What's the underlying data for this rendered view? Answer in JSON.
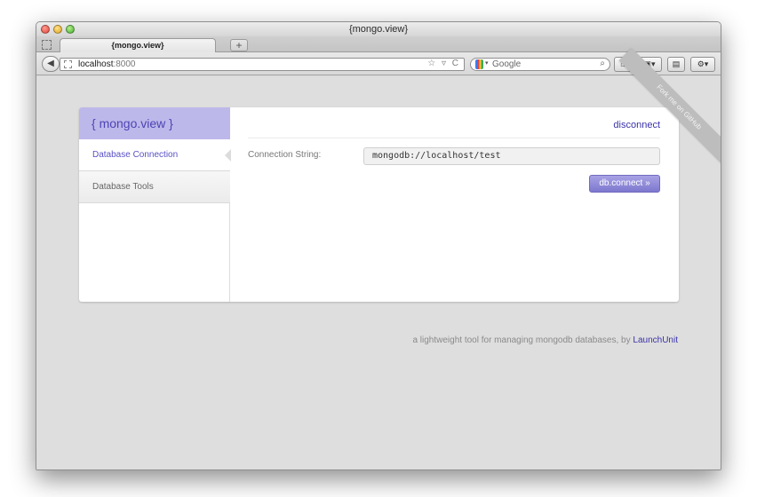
{
  "window": {
    "title": "{mongo.view}"
  },
  "browser": {
    "tab_title": "{mongo.view}",
    "new_tab_symbol": "+",
    "back_symbol": "◀",
    "url_host": "localhost",
    "url_port": ":8000",
    "url_icons": "☆ ▿ C",
    "search_placeholder": "Google",
    "search_icon": "🔍",
    "toolbar_buttons": [
      "home-icon",
      "bookmarks-icon",
      "page-icon",
      "tools-icon"
    ]
  },
  "app": {
    "brand": "{ mongo.view }",
    "nav": [
      {
        "label": "Database Connection",
        "active": true
      },
      {
        "label": "Database Tools",
        "active": false
      }
    ],
    "disconnect_label": "disconnect",
    "connection_label": "Connection String:",
    "connection_value": "mongodb://localhost/test",
    "connect_button": "db.connect »",
    "footer_text": "a lightweight tool for managing mongodb databases, by",
    "footer_link": "LaunchUnit",
    "ribbon_text": "Fork me on GitHub"
  },
  "colors": {
    "accent": "#5950c5",
    "brand_bg": "#bdb8ea",
    "link": "#3a33a8",
    "button": "#8a84d6"
  }
}
